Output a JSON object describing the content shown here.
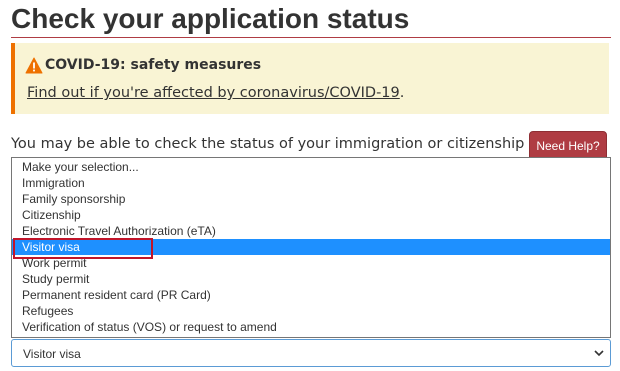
{
  "page": {
    "title": "Check your application status"
  },
  "alert": {
    "heading": "COVID-19: safety measures",
    "link_text": "Find out if you're affected by coronavirus/COVID-19",
    "link_suffix": ".",
    "icon": "warning-triangle-icon",
    "accent_color": "#ee7100",
    "background_color": "#f9f4d4"
  },
  "form": {
    "intro": "You may be able to check the status of your immigration or citizenship",
    "help_button_label": "Need Help?",
    "help_button_color": "#af3c43",
    "select": {
      "value": "Visitor visa",
      "icon": "chevron-down-icon",
      "highlight_color": "#1e90ff",
      "options": [
        "Make your selection...",
        "Immigration",
        "Family sponsorship",
        "Citizenship",
        "Electronic Travel Authorization (eTA)",
        "Visitor visa",
        "Work permit",
        "Study permit",
        "Permanent resident card (PR Card)",
        "Refugees",
        "Verification of status (VOS) or request to amend"
      ]
    }
  }
}
